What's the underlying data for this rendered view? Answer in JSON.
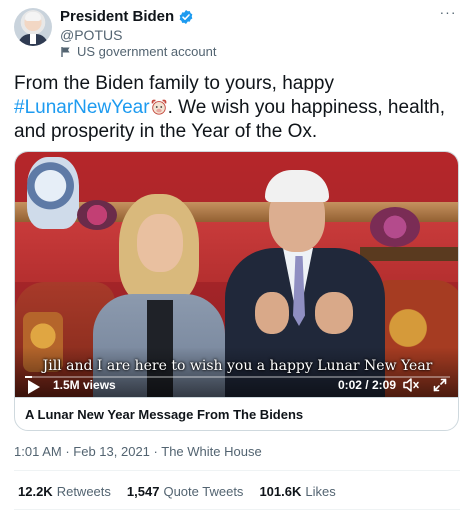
{
  "header": {
    "display_name": "President Biden",
    "handle": "@POTUS",
    "account_label": "US government account",
    "more_label": "···"
  },
  "tweet": {
    "text_before": "From the Biden family to yours, happy ",
    "hashtag": "#LunarNewYear",
    "text_after": ". We wish you happiness, health, and prosperity in the Year of the Ox."
  },
  "video": {
    "caption": "Jill and I are here to wish you a happy Lunar New Year",
    "views": "1.5M views",
    "time": "0:02 / 2:09",
    "progress": 0.016,
    "title": "A Lunar New Year Message From The Bidens"
  },
  "meta": {
    "time": "1:01 AM",
    "date": "Feb 13, 2021",
    "source": "The White House"
  },
  "stats": {
    "retweets_count": "12.2K",
    "retweets_label": "Retweets",
    "quotes_count": "1,547",
    "quotes_label": "Quote Tweets",
    "likes_count": "101.6K",
    "likes_label": "Likes"
  },
  "colors": {
    "accent": "#1d9bf0",
    "text": "#0f1419",
    "muted": "#536471"
  }
}
